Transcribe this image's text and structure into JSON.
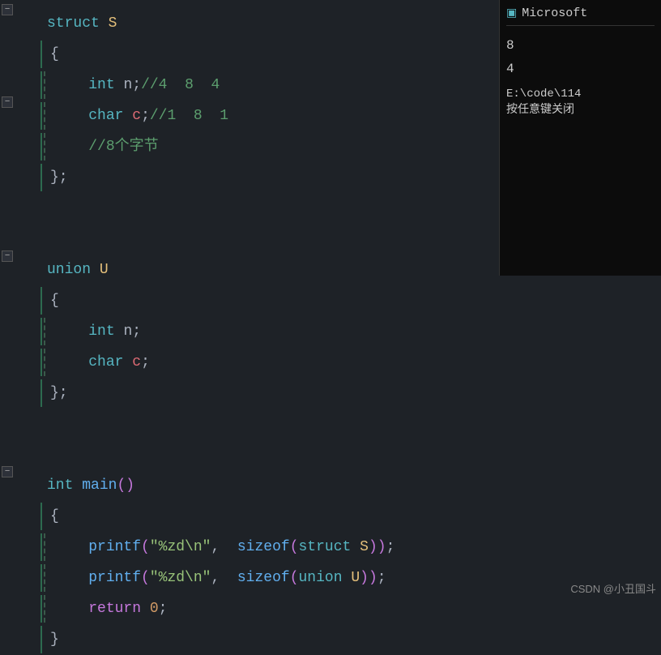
{
  "code": {
    "lines": [
      {
        "id": 1,
        "type": "struct-header",
        "fold": true,
        "indent": 0
      },
      {
        "id": 2,
        "type": "open-brace",
        "indent": 1
      },
      {
        "id": 3,
        "type": "int-n-comment",
        "indent": 2
      },
      {
        "id": 4,
        "type": "char-c-comment",
        "indent": 2,
        "fold": true
      },
      {
        "id": 5,
        "type": "comment-bytes",
        "indent": 2
      },
      {
        "id": 6,
        "type": "close-brace",
        "indent": 1
      },
      {
        "id": 7,
        "type": "blank"
      },
      {
        "id": 8,
        "type": "blank"
      },
      {
        "id": 9,
        "type": "union-header",
        "fold": true,
        "indent": 0
      },
      {
        "id": 10,
        "type": "open-brace2",
        "indent": 1
      },
      {
        "id": 11,
        "type": "int-n2",
        "indent": 2
      },
      {
        "id": 12,
        "type": "char-c2",
        "indent": 2
      },
      {
        "id": 13,
        "type": "close-brace2",
        "indent": 1
      },
      {
        "id": 14,
        "type": "blank"
      },
      {
        "id": 15,
        "type": "blank"
      },
      {
        "id": 16,
        "type": "main-header",
        "fold": true,
        "indent": 0
      },
      {
        "id": 17,
        "type": "open-brace3",
        "indent": 1
      },
      {
        "id": 18,
        "type": "printf1",
        "indent": 2
      },
      {
        "id": 19,
        "type": "printf2",
        "indent": 2
      },
      {
        "id": 20,
        "type": "return0",
        "indent": 2
      },
      {
        "id": 21,
        "type": "close-brace3",
        "indent": 1
      }
    ]
  },
  "terminal": {
    "title": "Microsoft",
    "output_line1": "8",
    "output_line2": "4",
    "path": "E:\\code\\114",
    "press_key_text": "按任意键关闭"
  },
  "watermark": {
    "text": "CSDN @小丑国斗"
  }
}
